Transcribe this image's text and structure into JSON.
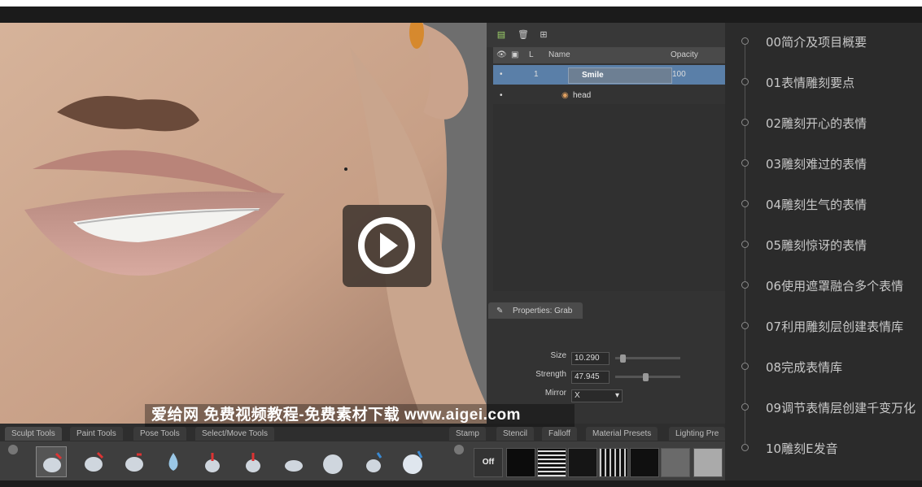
{
  "layers_panel": {
    "columns": {
      "name": "Name",
      "opacity": "Opacity",
      "lock": "L"
    },
    "rows": [
      {
        "index": "1",
        "name": "Smile",
        "opacity": "100",
        "selected": true
      },
      {
        "index": "",
        "name": "head",
        "opacity": "",
        "selected": false
      }
    ]
  },
  "properties": {
    "tab": "Properties: Grab",
    "size_label": "Size",
    "size_value": "10.290",
    "strength_label": "Strength",
    "strength_value": "47.945",
    "mirror_label": "Mirror",
    "mirror_value": "X"
  },
  "tool_tabs": [
    "Sculpt Tools",
    "Paint Tools",
    "Pose Tools",
    "Select/Move Tools"
  ],
  "stamp_tabs": [
    "Stamp",
    "Stencil",
    "Falloff",
    "Material Presets",
    "Lighting Pre"
  ],
  "stamp_off": "Off",
  "watermark": "爱给网   免费视频教程-免费素材下载   www.aigei.com",
  "chapters": [
    "00简介及项目概要",
    "01表情雕刻要点",
    "02雕刻开心的表情",
    "03雕刻难过的表情",
    "04雕刻生气的表情",
    "05雕刻惊讶的表情",
    "06使用遮罩融合多个表情",
    "07利用雕刻层创建表情库",
    "08完成表情库",
    "09调节表情层创建千变万化",
    "10雕刻E发音"
  ],
  "icons": {
    "play": "play-icon"
  }
}
